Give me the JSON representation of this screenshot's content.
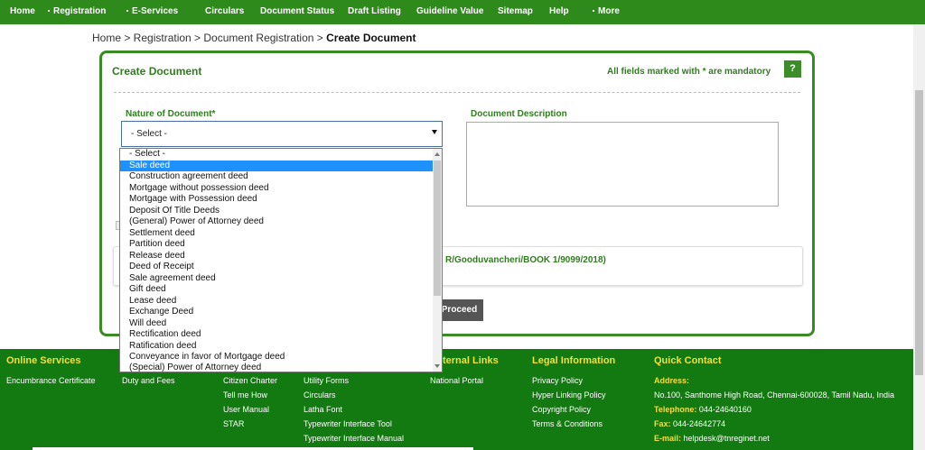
{
  "nav": {
    "items": [
      {
        "label": "Home",
        "dot": false
      },
      {
        "label": "Registration",
        "dot": true
      },
      {
        "label": "E-Services",
        "dot": true
      },
      {
        "label": "Circulars",
        "dot": false
      },
      {
        "label": "Document Status",
        "dot": false
      },
      {
        "label": "Draft Listing",
        "dot": false
      },
      {
        "label": "Guideline Value",
        "dot": false
      },
      {
        "label": "Sitemap",
        "dot": false
      },
      {
        "label": "Help",
        "dot": false
      },
      {
        "label": "More",
        "dot": true
      }
    ]
  },
  "breadcrumb": {
    "path": "Home > Registration > Document Registration > ",
    "current": "Create Document"
  },
  "form": {
    "title": "Create Document",
    "mandatory_note": "All fields marked with * are mandatory",
    "help_label": "?",
    "nature_label": "Nature of Document*",
    "nature_selected": "- Select -",
    "description_label": "Document Description",
    "reference_text": "R/Gooduvancheri/BOOK 1/9099/2018)",
    "proceed_label": "Proceed"
  },
  "dropdown": {
    "selected_index": 1,
    "options": [
      "- Select -",
      "Sale deed",
      "Construction agreement deed",
      "Mortgage without possession deed",
      "Mortgage with Possession deed",
      "Deposit Of Title Deeds",
      "(General) Power of Attorney deed",
      "Settlement deed",
      "Partition deed",
      "Release deed",
      "Deed of Receipt",
      "Sale agreement deed",
      "Gift deed",
      "Lease deed",
      "Exchange Deed",
      "Will deed",
      "Rectification deed",
      "Ratification deed",
      "Conveyance in favor of Mortgage deed",
      "(Special) Power of Attorney deed"
    ]
  },
  "footer": {
    "online_services": {
      "heading": "Online Services",
      "links": [
        "Encumbrance Certificate"
      ]
    },
    "col2": {
      "links": [
        "Duty and Fees"
      ]
    },
    "col3": {
      "links": [
        "Citizen Charter",
        "Tell me How",
        "User Manual",
        "STAR"
      ]
    },
    "col4": {
      "links": [
        "Utility Forms",
        "Circulars",
        "Latha Font",
        "Typewriter Interface Tool",
        "Typewriter Interface Manual"
      ]
    },
    "external_links": {
      "heading": "ternal Links",
      "links": [
        "National Portal"
      ]
    },
    "legal": {
      "heading": "Legal Information",
      "links": [
        "Privacy Policy",
        "Hyper Linking Policy",
        "Copyright Policy",
        "Terms & Conditions"
      ]
    },
    "contact": {
      "heading": "Quick Contact",
      "address_label": "Address:",
      "address": "No.100, Santhome High Road, Chennai-600028, Tamil Nadu, India",
      "telephone_label": "Telephone:",
      "telephone": "044-24640160",
      "fax_label": "Fax:",
      "fax": "044-24642774",
      "email_label": "E-mail:",
      "email": "helpdesk@tnreginet.net"
    }
  },
  "colors": {
    "nav_green": "#2f8a1c",
    "footer_green": "#127a10",
    "accent_yellow": "#f0e040",
    "highlight_blue": "#1e90ff"
  }
}
